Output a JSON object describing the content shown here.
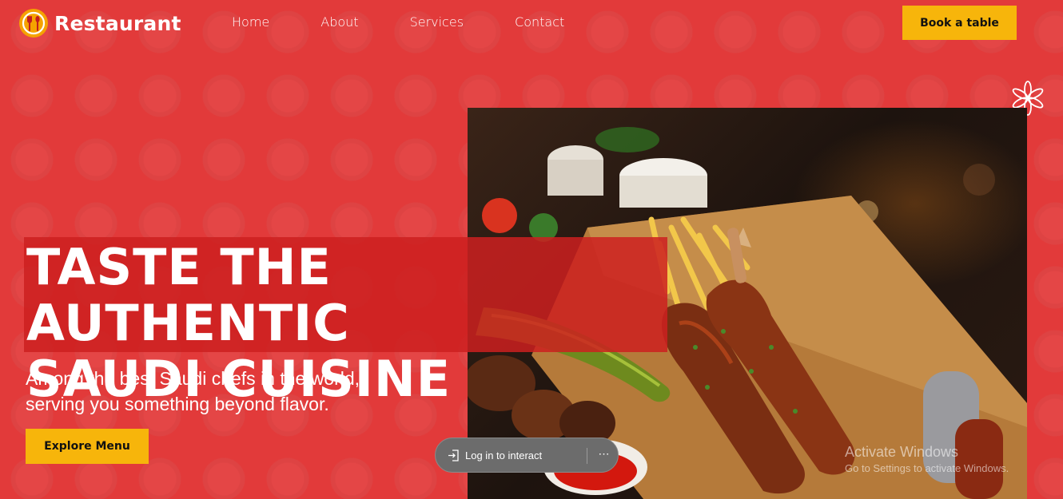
{
  "brand": {
    "name": "Restaurant",
    "icon": "fork-spoon-icon",
    "icon_color": "#f5a300"
  },
  "nav": {
    "links": [
      "Home",
      "About",
      "Services",
      "Contact"
    ],
    "cta_label": "Book a table"
  },
  "hero": {
    "headline_line1": "TASTE THE AUTHENTIC",
    "headline_line2": "SAUDI CUISINE",
    "subline_line1": "Among the best Saudi chefs in the world,",
    "subline_line2": "serving you something beyond flavor.",
    "cta_label": "Explore Menu",
    "image": "grilled-ribs-platter-image",
    "decoration": "flower-icon"
  },
  "overlay": {
    "login_label": "Log in to interact",
    "login_icon": "sign-in-icon",
    "more_label": "⋯"
  },
  "watermark": {
    "title": "Activate Windows",
    "subtitle": "Go to Settings to activate Windows."
  },
  "colors": {
    "background": "#e23a3a",
    "accent": "#f7b50b",
    "headline_band": "#cd2020"
  }
}
